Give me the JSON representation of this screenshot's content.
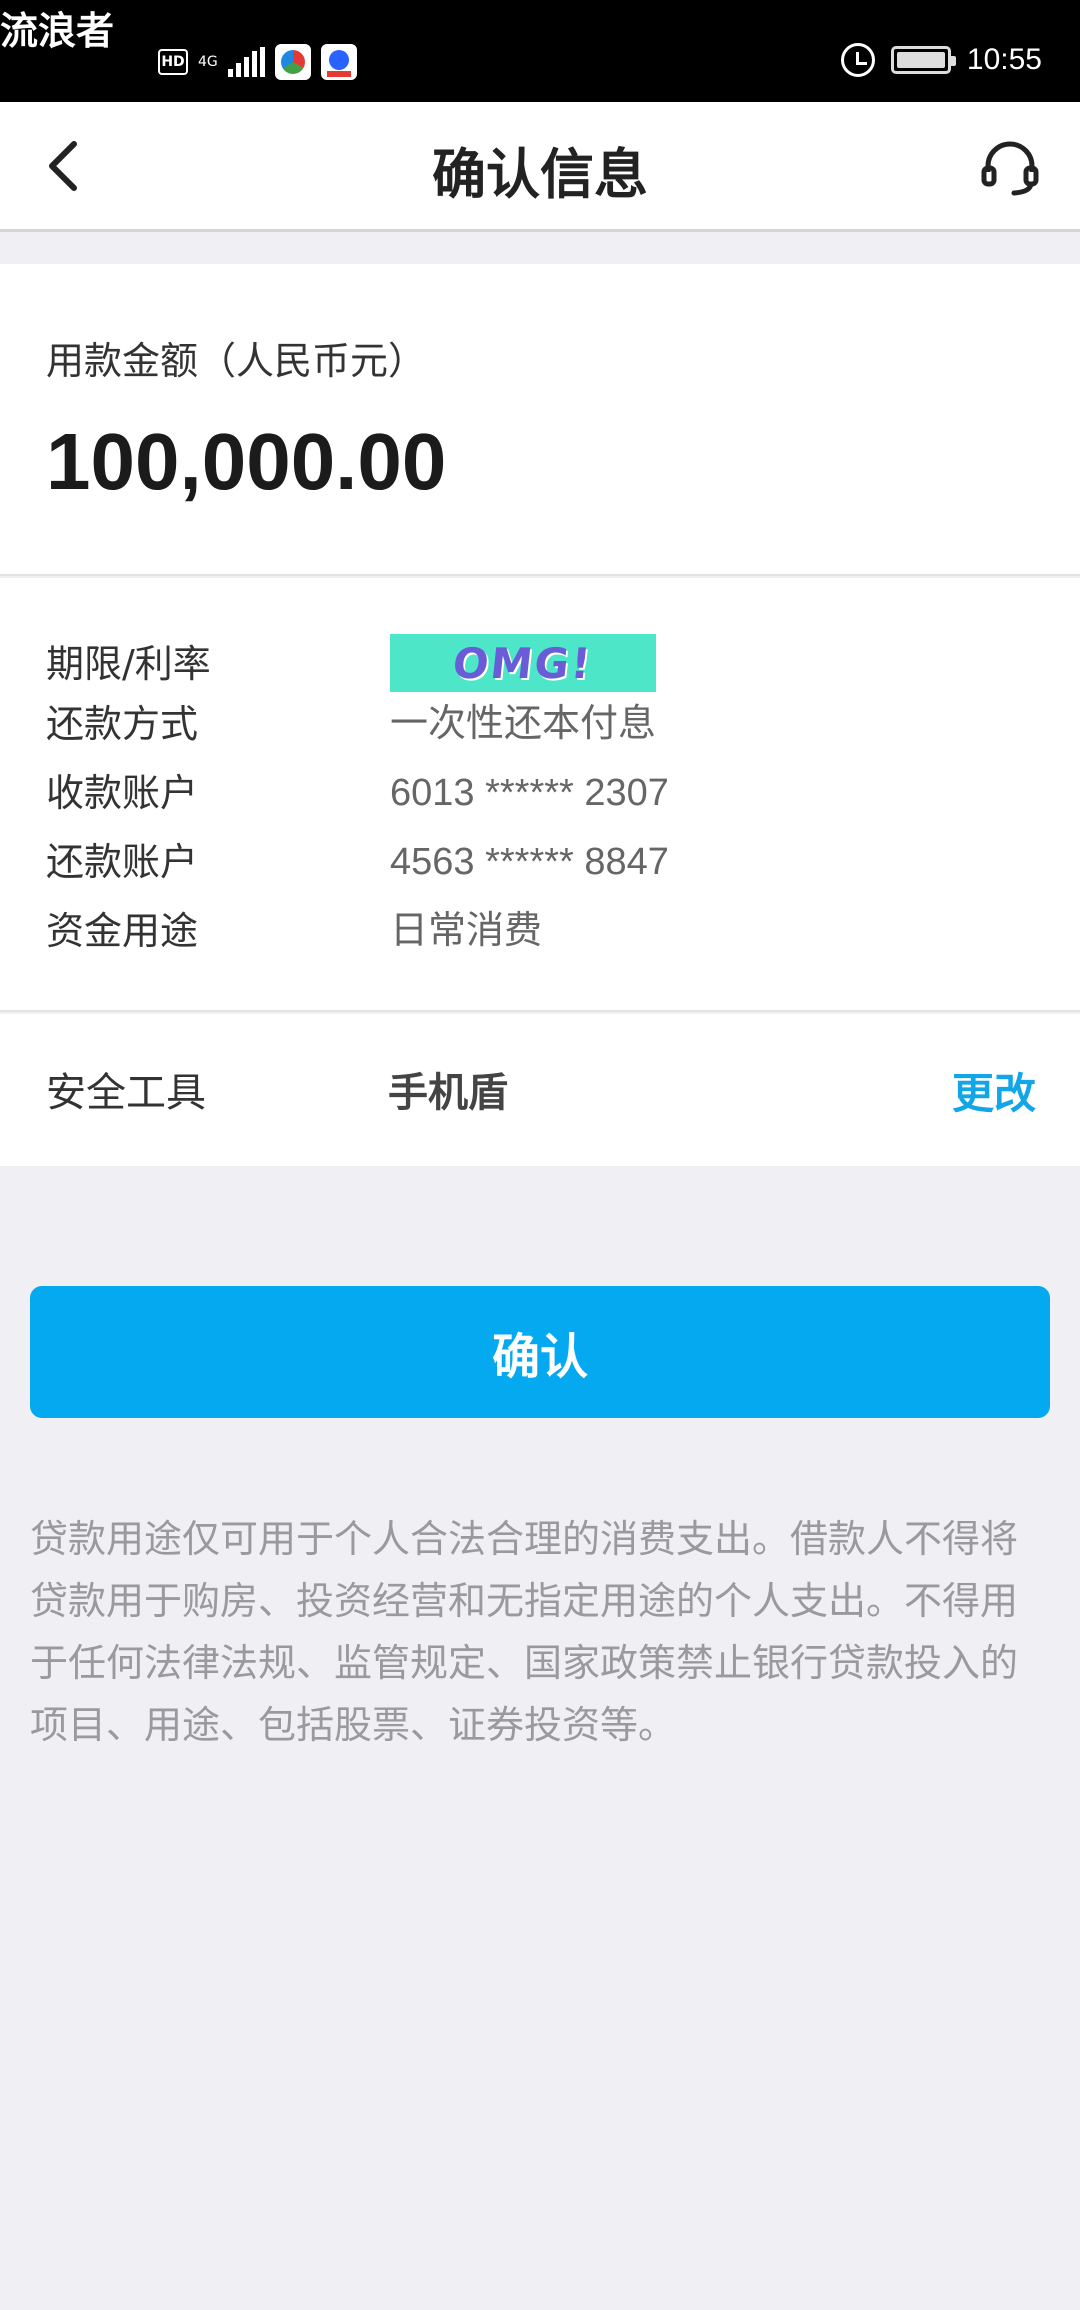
{
  "status_bar": {
    "watermark": "流浪者",
    "hd": "HD",
    "network": "4G",
    "time": "10:55"
  },
  "nav": {
    "title": "确认信息",
    "back_icon": "chevron-left-icon",
    "support_icon": "headset-icon"
  },
  "amount": {
    "label": "用款金额（人民币元）",
    "value": "100,000.00"
  },
  "details": {
    "sticker": "OMG!",
    "rows": [
      {
        "label": "期限/利率",
        "value": ""
      },
      {
        "label": "还款方式",
        "value": "一次性还本付息"
      },
      {
        "label": "收款账户",
        "value": "6013 ****** 2307"
      },
      {
        "label": "还款账户",
        "value": "4563 ****** 8847"
      },
      {
        "label": "资金用途",
        "value": "日常消费"
      }
    ]
  },
  "security": {
    "label": "安全工具",
    "value": "手机盾",
    "change": "更改"
  },
  "confirm_label": "确认",
  "notice": "贷款用途仅可用于个人合法合理的消费支出。借款人不得将贷款用于购房、投资经营和无指定用途的个人支出。不得用于任何法律法规、监管规定、国家政策禁止银行贷款投入的项目、用途、包括股票、证券投资等。",
  "colors": {
    "accent": "#05a9ef",
    "link": "#11a6e8",
    "background": "#efeff4"
  }
}
